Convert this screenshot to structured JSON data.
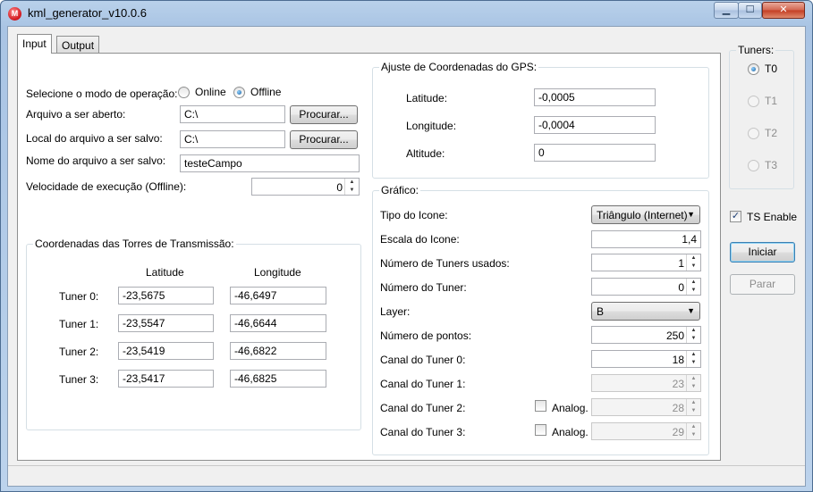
{
  "window": {
    "title": "kml_generator_v10.0.6",
    "icon_letter": "M",
    "minimize": "▁",
    "maximize": "☐",
    "close": "✕"
  },
  "tabs": [
    {
      "label": "Input",
      "active": true
    },
    {
      "label": "Output",
      "active": false
    }
  ],
  "input": {
    "mode_label": "Selecione o modo de operação:",
    "mode_options": [
      "Online",
      "Offline"
    ],
    "mode_selected": "Offline",
    "open_file_label": "Arquivo a ser aberto:",
    "open_file_value": "C:\\",
    "save_location_label": "Local do arquivo a ser salvo:",
    "save_location_value": "C:\\",
    "save_name_label": "Nome do arquivo a ser salvo:",
    "save_name_value": "testeCampo",
    "browse_label": "Procurar...",
    "speed_label": "Velocidade de execução (Offline):",
    "speed_value": "0"
  },
  "towers": {
    "title": "Coordenadas das Torres de Transmissão:",
    "col_latitude": "Latitude",
    "col_longitude": "Longitude",
    "rows": [
      {
        "label": "Tuner 0:",
        "lat": "-23,5675",
        "lon": "-46,6497"
      },
      {
        "label": "Tuner 1:",
        "lat": "-23,5547",
        "lon": "-46,6644"
      },
      {
        "label": "Tuner 2:",
        "lat": "-23,5419",
        "lon": "-46,6822"
      },
      {
        "label": "Tuner 3:",
        "lat": "-23,5417",
        "lon": "-46,6825"
      }
    ]
  },
  "gps": {
    "title": "Ajuste de Coordenadas do GPS:",
    "latitude_label": "Latitude:",
    "latitude_value": "-0,0005",
    "longitude_label": "Longitude:",
    "longitude_value": "-0,0004",
    "altitude_label": "Altitude:",
    "altitude_value": "0"
  },
  "grafico": {
    "title": "Gráfico:",
    "icon_type_label": "Tipo do Icone:",
    "icon_type_value": "Triângulo (Internet)",
    "icon_scale_label": "Escala do Icone:",
    "icon_scale_value": "1,4",
    "tuners_used_label": "Número de Tuners usados:",
    "tuners_used_value": "1",
    "tuner_number_label": "Número do Tuner:",
    "tuner_number_value": "0",
    "layer_label": "Layer:",
    "layer_value": "B",
    "points_label": "Número de pontos:",
    "points_value": "250",
    "ch0_label": "Canal do Tuner 0:",
    "ch0_value": "18",
    "ch1_label": "Canal do Tuner 1:",
    "ch1_value": "23",
    "ch2_label": "Canal do Tuner 2:",
    "ch2_value": "28",
    "ch3_label": "Canal do Tuner 3:",
    "ch3_value": "29",
    "analog_label": "Analog."
  },
  "sidebar": {
    "tuners_title": "Tuners:",
    "tuners": [
      "T0",
      "T1",
      "T2",
      "T3"
    ],
    "tuner_selected": "T0",
    "ts_enable_label": "TS Enable",
    "ts_enable_checked": true,
    "start_label": "Iniciar",
    "stop_label": "Parar"
  }
}
